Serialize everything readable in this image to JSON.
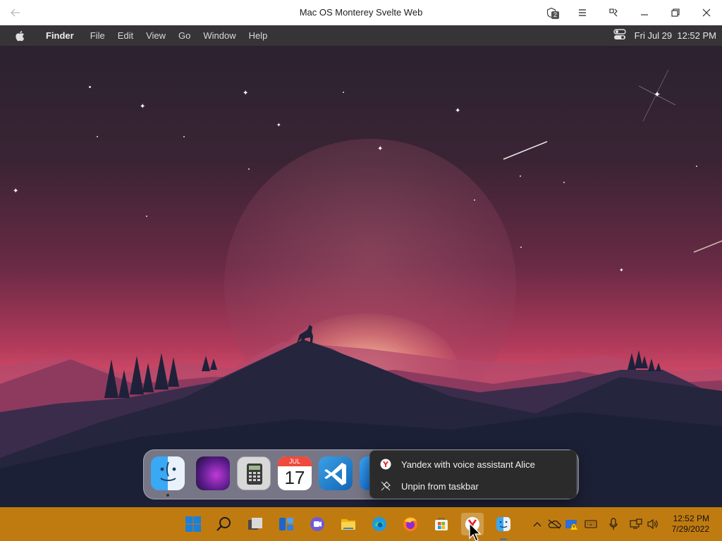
{
  "window": {
    "title": "Mac OS Monterey Svelte Web",
    "extension_badge": "2",
    "back_icon": "back-arrow-icon"
  },
  "menubar": {
    "apple_icon": "apple-logo-icon",
    "items": [
      "Finder",
      "File",
      "Edit",
      "View",
      "Go",
      "Window",
      "Help"
    ],
    "datetime": "Fri Jul 29  12:52 PM",
    "control_center_icon": "control-center-icon"
  },
  "dock": {
    "apps": [
      {
        "name": "Finder",
        "icon": "finder-icon"
      },
      {
        "name": "Launchpad",
        "icon": "launchpad-icon"
      },
      {
        "name": "Calculator",
        "icon": "calculator-icon"
      },
      {
        "name": "Calendar",
        "icon": "calendar-icon",
        "month": "JUL",
        "day": "17"
      },
      {
        "name": "VS Code",
        "icon": "vscode-icon"
      },
      {
        "name": "App Store",
        "icon": "app-store-icon"
      }
    ]
  },
  "context_menu": {
    "items": [
      {
        "label": "Yandex with voice assistant Alice",
        "icon": "yandex-icon"
      },
      {
        "label": "Unpin from taskbar",
        "icon": "unpin-icon"
      }
    ]
  },
  "taskbar": {
    "apps": [
      "start-icon",
      "search-icon",
      "task-view-icon",
      "widgets-icon",
      "teams-chat-icon",
      "file-explorer-icon",
      "edge-icon",
      "firefox-icon",
      "microsoft-store-icon",
      "yandex-browser-icon",
      "finder-pwa-icon"
    ],
    "clock_time": "12:52 PM",
    "clock_date": "7/29/2022"
  },
  "colors": {
    "taskbar": "#c07b10",
    "menubar": "#3c383c",
    "context_menu": "#2b2b2b"
  }
}
